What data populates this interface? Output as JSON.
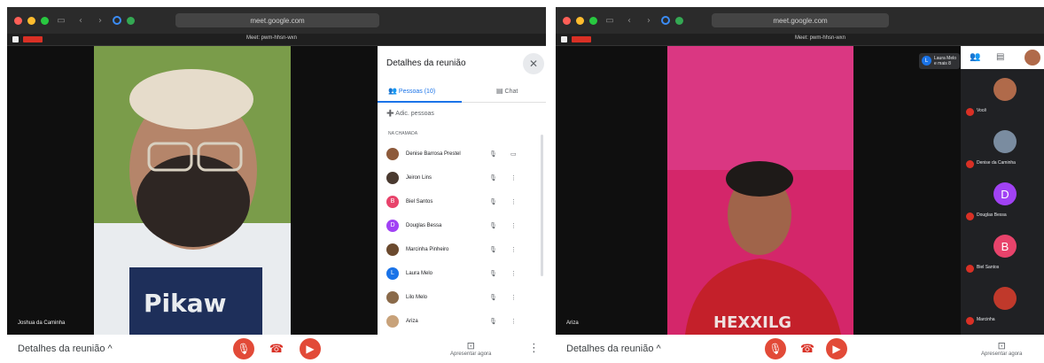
{
  "left": {
    "url": "meet.google.com",
    "tab_title": "Meet: pwm-hhsn-wxn",
    "video": {
      "name_label": "Joshua da Caminha"
    },
    "bottom_bar": {
      "details_label": "Detalhes da reunião",
      "details_chevron": "^",
      "present_label": "Apresentar agora",
      "mic_icon": "mic-off-icon",
      "hangup_icon": "phone-hangup-icon",
      "cam_icon": "camera-off-icon"
    },
    "panel": {
      "title": "Detalhes da reunião",
      "tabs": {
        "people": "Pessoas (10)",
        "chat": "Chat"
      },
      "add_people": "Adic. pessoas",
      "section_label": "NA CHAMADA",
      "participants": [
        {
          "name": "Denise Barrosa Prestel",
          "initial": "",
          "color": "#8d5a3b"
        },
        {
          "name": "Jeiron Lins",
          "initial": "",
          "color": "#4a3a30"
        },
        {
          "name": "Biel Santos",
          "initial": "B",
          "color": "#e8436b"
        },
        {
          "name": "Douglas Bessa",
          "initial": "D",
          "color": "#a142f4"
        },
        {
          "name": "Marcinha Pinheiro",
          "initial": "",
          "color": "#6b4a2e"
        },
        {
          "name": "Laura Melo",
          "initial": "L",
          "color": "#1a73e8"
        },
        {
          "name": "Lilo Melo",
          "initial": "",
          "color": "#8a6a4a"
        },
        {
          "name": "Ariza",
          "initial": "",
          "color": "#c8a27a"
        }
      ]
    }
  },
  "right": {
    "url": "meet.google.com",
    "tab_title": "Meet: pwm-hhsn-wxn",
    "you_tag": {
      "initial": "L",
      "line1": "Laura Melo",
      "line2": "e mais 8"
    },
    "video": {
      "name_label": "Ariza"
    },
    "rail": {
      "tiles": [
        {
          "name": "Você",
          "initial": "",
          "color": "#b06a4a"
        },
        {
          "name": "Denise da Caminha",
          "initial": "",
          "color": "#7a8ca0"
        },
        {
          "name": "Douglas Bessa",
          "initial": "D",
          "color": "#a142f4"
        },
        {
          "name": "Biel Santos",
          "initial": "B",
          "color": "#e8436b"
        },
        {
          "name": "Marcinha",
          "initial": "",
          "color": "#c0392b"
        }
      ]
    },
    "bottom_bar": {
      "details_label": "Detalhes da reunião",
      "details_chevron": "^",
      "present_label": "Apresentar agora"
    }
  },
  "colors": {
    "red_control": "#e24a38",
    "blue_accent": "#1a73e8",
    "left_wall": "#7a9c4a",
    "right_wall": "#d4266a",
    "shirt_red": "#c4202a"
  }
}
